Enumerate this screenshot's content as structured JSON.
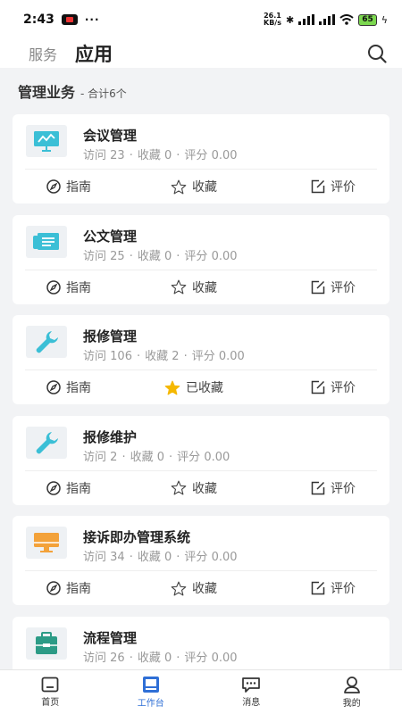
{
  "status_bar": {
    "time": "2:43",
    "dots": "···",
    "net_speed_top": "26.1",
    "net_speed_bottom": "KB/s",
    "battery": "65"
  },
  "header": {
    "tab_service": "服务",
    "tab_app": "应用"
  },
  "section": {
    "title": "管理业务",
    "count": "- 合计6个"
  },
  "labels": {
    "visits": "访问",
    "favorites": "收藏",
    "rating": "评分",
    "guide": "指南",
    "favorite": "收藏",
    "favorited": "已收藏",
    "review": "评价"
  },
  "cards": [
    {
      "name": "会议管理",
      "visits": "23",
      "favorites": "0",
      "rating": "0.00",
      "favorite_label": "收藏",
      "icon": "presentation-icon",
      "favorited": false
    },
    {
      "name": "公文管理",
      "visits": "25",
      "favorites": "0",
      "rating": "0.00",
      "favorite_label": "收藏",
      "icon": "document-icon",
      "favorited": false
    },
    {
      "name": "报修管理",
      "visits": "106",
      "favorites": "2",
      "rating": "0.00",
      "favorite_label": "已收藏",
      "icon": "wrench-icon",
      "favorited": true
    },
    {
      "name": "报修维护",
      "visits": "2",
      "favorites": "0",
      "rating": "0.00",
      "favorite_label": "收藏",
      "icon": "wrench-icon",
      "favorited": false
    },
    {
      "name": "接诉即办管理系统",
      "visits": "34",
      "favorites": "0",
      "rating": "0.00",
      "favorite_label": "收藏",
      "icon": "monitor-icon",
      "favorited": false
    },
    {
      "name": "流程管理",
      "visits": "26",
      "favorites": "0",
      "rating": "0.00",
      "favorite_label": "收藏",
      "icon": "toolbox-icon",
      "favorited": false
    }
  ],
  "tab_bar": {
    "home": "首页",
    "workbench": "工作台",
    "messages": "消息",
    "mine": "我的"
  },
  "colors": {
    "accent": "#2f6fd6",
    "icon_teal": "#3bbfd6",
    "icon_orange": "#f3a23a",
    "icon_green": "#2c9b86",
    "star_filled": "#f5b800"
  }
}
